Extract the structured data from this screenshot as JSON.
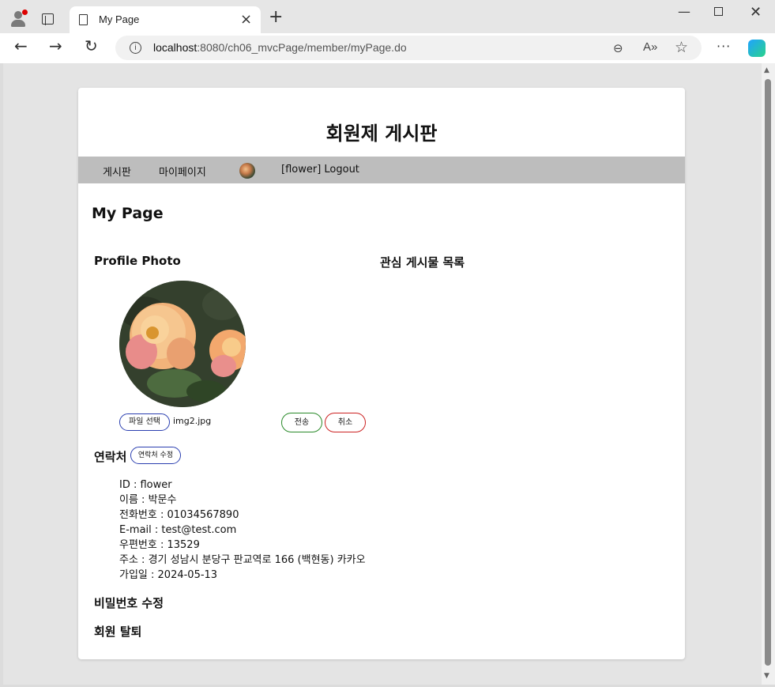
{
  "browser": {
    "tab_title": "My Page",
    "url_host": "localhost",
    "url_rest": ":8080/ch06_mvcPage/member/myPage.do",
    "icons": [
      "profile-icon",
      "tab-actions-icon",
      "page-icon",
      "close-icon",
      "plus-icon",
      "minimize-icon",
      "maximize-icon",
      "close-window-icon",
      "back-arrow-icon",
      "forward-arrow-icon",
      "reload-icon",
      "info-icon",
      "zoom-icon",
      "read-aloud-icon",
      "star-icon",
      "more-icon",
      "copilot-icon"
    ]
  },
  "site": {
    "title": "회원제 게시판",
    "menu": {
      "board": "게시판",
      "mypage": "마이페이지",
      "logout": "[flower] Logout"
    }
  },
  "mypage": {
    "heading": "My Page",
    "profile_heading": "Profile Photo",
    "favorites_heading": "관심 게시물 목록",
    "file_button": "파일 선택",
    "file_name": "img2.jpg",
    "send_button": "전송",
    "cancel_button": "취소",
    "contact_heading": "연락처",
    "edit_contact_button": "연락처 수정",
    "info": {
      "id": "ID : flower",
      "name": "이름 : 박문수",
      "phone": "전화번호 : 01034567890",
      "email": "E-mail : test@test.com",
      "zipcode": "우편번호 : 13529",
      "address": "주소 : 경기 성남시 분당구 판교역로 166 (백현동) 카카오",
      "joined": "가입일 : 2024-05-13"
    },
    "password_heading": "비밀번호 수정",
    "withdraw_heading": "회원 탈퇴"
  },
  "colors": {
    "menubar": "#bdbdbd",
    "file_button_border": "#2b3fb0",
    "send_button_border": "#2a8a2a",
    "cancel_button_border": "#cc2222"
  }
}
